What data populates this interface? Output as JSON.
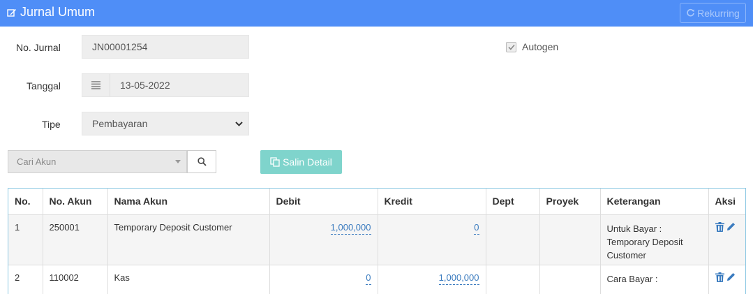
{
  "header": {
    "title": "Jurnal Umum",
    "rekurring_label": "Rekurring"
  },
  "form": {
    "no_jurnal_label": "No. Jurnal",
    "no_jurnal_value": "JN00001254",
    "tanggal_label": "Tanggal",
    "tanggal_value": "13-05-2022",
    "tipe_label": "Tipe",
    "tipe_value": "Pembayaran",
    "autogen_label": "Autogen",
    "autogen_checked": true
  },
  "search": {
    "placeholder": "Cari Akun",
    "salin_label": "Salin Detail"
  },
  "table": {
    "headers": [
      "No.",
      "No. Akun",
      "Nama Akun",
      "Debit",
      "Kredit",
      "Dept",
      "Proyek",
      "Keterangan",
      "Aksi"
    ],
    "rows": [
      {
        "no": "1",
        "no_akun": "250001",
        "nama_akun": "Temporary Deposit Customer",
        "debit": "1,000,000",
        "kredit": "0",
        "dept": "",
        "proyek": "",
        "keterangan": "Untuk Bayar : Temporary Deposit Customer"
      },
      {
        "no": "2",
        "no_akun": "110002",
        "nama_akun": "Kas",
        "debit": "0",
        "kredit": "1,000,000",
        "dept": "",
        "proyek": "",
        "keterangan": "Cara Bayar :"
      }
    ]
  },
  "icons": {
    "edit": "edit-icon",
    "refresh": "refresh-icon",
    "calendar": "calendar-icon",
    "search": "search-icon",
    "copy": "copy-icon",
    "trash": "trash-icon",
    "pencil": "pencil-icon"
  },
  "colors": {
    "header_bg": "#4f8ef7",
    "salin_bg": "#7fd4cc",
    "table_border": "#8cc8e3",
    "link": "#3a7bbf"
  }
}
